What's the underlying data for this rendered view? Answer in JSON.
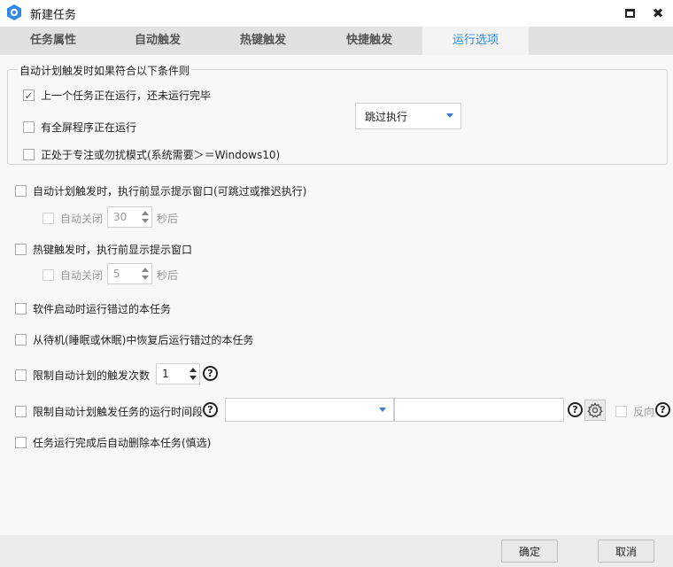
{
  "window": {
    "title": "新建任务",
    "icons": {
      "logo": "app-logo-icon",
      "maximize": "maximize-icon",
      "close": "close-icon"
    },
    "close_glyph": "✖"
  },
  "tabs": [
    {
      "label": "任务属性",
      "active": false
    },
    {
      "label": "自动触发",
      "active": false
    },
    {
      "label": "热键触发",
      "active": false
    },
    {
      "label": "快捷触发",
      "active": false
    },
    {
      "label": "运行选项",
      "active": true
    }
  ],
  "group": {
    "legend": "自动计划触发时如果符合以下条件则",
    "options": [
      {
        "label": "上一个任务正在运行，还未运行完毕",
        "checked": true
      },
      {
        "label": "有全屏程序正在运行",
        "checked": false
      },
      {
        "label": "正处于专注或勿扰模式(系统需要＞＝Windows10)",
        "checked": false
      }
    ],
    "action_select": "跳过执行"
  },
  "options": {
    "schedule_prompt": {
      "label": "自动计划触发时，执行前显示提示窗口(可跳过或推迟执行)",
      "checked": false
    },
    "schedule_autoclose": {
      "label": "自动关闭",
      "checked": false,
      "value": "30",
      "unit": "秒后"
    },
    "hotkey_prompt": {
      "label": "热键触发时，执行前显示提示窗口",
      "checked": false
    },
    "hotkey_autoclose": {
      "label": "自动关闭",
      "checked": false,
      "value": "5",
      "unit": "秒后"
    },
    "run_missed_on_start": {
      "label": "软件启动时运行错过的本任务",
      "checked": false
    },
    "run_missed_on_resume": {
      "label": "从待机(睡眠或休眠)中恢复后运行错过的本任务",
      "checked": false
    },
    "limit_count": {
      "label": "限制自动计划的触发次数",
      "checked": false,
      "value": "1"
    },
    "limit_period": {
      "label": "限制自动计划触发任务的运行时间段",
      "checked": false,
      "select_value": "",
      "text_value": "",
      "reverse_label": "反向",
      "reverse_checked": false
    },
    "auto_delete": {
      "label": "任务运行完成后自动删除本任务(慎选)",
      "checked": false
    }
  },
  "help_glyph": "?",
  "footer": {
    "ok": "确定",
    "cancel": "取消"
  }
}
